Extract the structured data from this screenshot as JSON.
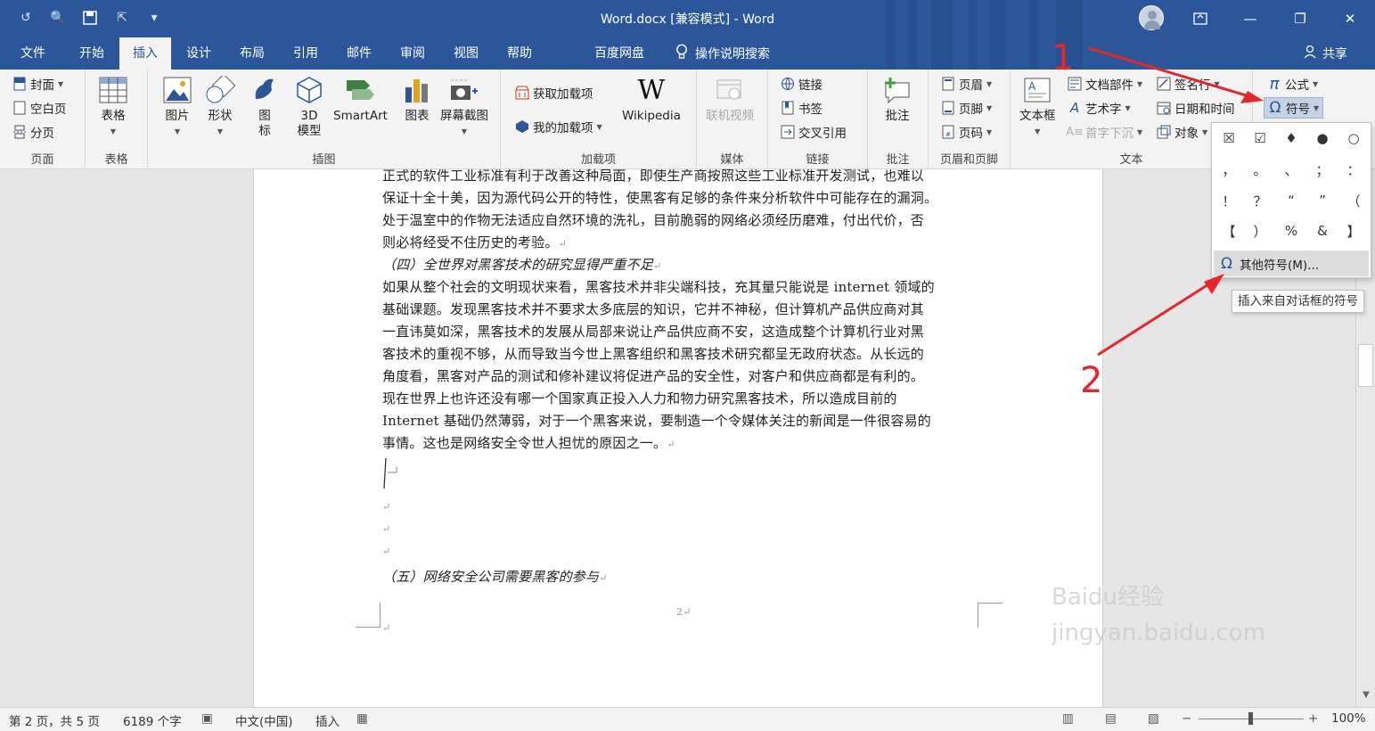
{
  "window": {
    "title": "Word.docx [兼容模式] - Word"
  },
  "tabs": [
    {
      "label": "文件"
    },
    {
      "label": "开始"
    },
    {
      "label": "插入",
      "active": true
    },
    {
      "label": "设计"
    },
    {
      "label": "布局"
    },
    {
      "label": "引用"
    },
    {
      "label": "邮件"
    },
    {
      "label": "审阅"
    },
    {
      "label": "视图"
    },
    {
      "label": "帮助"
    },
    {
      "label": "百度网盘"
    }
  ],
  "tellme": "操作说明搜索",
  "share": "共享",
  "ribbon": {
    "pages": {
      "label": "页面",
      "cover": "封面",
      "blank": "空白页",
      "break": "分页"
    },
    "table": {
      "label": "表格",
      "table": "表格"
    },
    "illustrations": {
      "label": "插图",
      "picture": "图片",
      "shapes": "形状",
      "icons": "图标",
      "model3d": "3D\n模型",
      "smartart": "SmartArt",
      "chart": "图表",
      "screenshot": "屏幕截图"
    },
    "addins": {
      "label": "加载项",
      "get": "获取加载项",
      "my": "我的加载项",
      "wikipedia": "Wikipedia"
    },
    "media": {
      "label": "媒体",
      "video": "联机视频"
    },
    "links": {
      "label": "链接",
      "link": "链接",
      "bookmark": "书签",
      "crossref": "交叉引用"
    },
    "comments": {
      "label": "批注",
      "comment": "批注"
    },
    "headerfooter": {
      "label": "页眉和页脚",
      "header": "页眉",
      "footer": "页脚",
      "pagenum": "页码"
    },
    "text": {
      "label": "文本",
      "textbox": "文本框",
      "parts": "文档部件",
      "wordart": "艺术字",
      "dropcap": "首字下沉",
      "signature": "签名行",
      "datetime": "日期和时间",
      "object": "对象"
    },
    "symbols": {
      "equation": "公式",
      "symbol": "符号"
    }
  },
  "document": {
    "lines": [
      "正式的软件工业标准有利于改善这种局面，即使生产商按照这些工业标准开发测试，也难以",
      "保证十全十美，因为源代码公开的特性，使黑客有足够的条件来分析软件中可能存在的漏洞。",
      "处于温室中的作物无法适应自然环境的洗礼，目前脆弱的网络必须经历磨难，付出代价，否",
      "则必将经受不住历史的考验。",
      "（四）全世界对黑客技术的研究显得严重不足",
      "如果从整个社会的文明现状来看，黑客技术并非尖端科技，充其量只能说是 internet 领域的",
      "基础课题。发现黑客技术并不要求太多底层的知识，它并不神秘，但计算机产品供应商对其",
      "一直讳莫如深，黑客技术的发展从局部来说让产品供应商不安，这造成整个计算机行业对黑",
      "客技术的重视不够，从而导致当今世上黑客组织和黑客技术研究都呈无政府状态。从长远的",
      "角度看，黑客对产品的测试和修补建议将促进产品的安全性，对客户和供应商都是有利的。",
      "现在世界上也许还没有哪一个国家真正投入人力和物力研究黑客技术，所以造成目前的",
      "Internet 基础仍然薄弱，对于一个黑客来说，要制造一个令媒体关注的新闻是一件很容易的",
      "事情。这也是网络安全令世人担忧的原因之一。"
    ],
    "heading5": "（五）网络安全公司需要黑客的参与",
    "page_number": "2"
  },
  "symbol_menu": {
    "symbols": [
      "☒",
      "☑",
      "♦",
      "●",
      "○",
      "，",
      "。",
      "、",
      "；",
      "：",
      "！",
      "？",
      "“",
      "”",
      "（",
      "【",
      "）",
      "%",
      "&",
      "】"
    ],
    "more": "其他符号(M)...",
    "tooltip": "插入来自对话框的符号"
  },
  "annotations": {
    "one": "1",
    "two": "2",
    "color": "#e8262a"
  },
  "status": {
    "page": "第 2 页，共 5 页",
    "words": "6189 个字",
    "lang": "中文(中国)",
    "mode": "插入",
    "zoom": "100%"
  },
  "watermark": "Baidu经验\njingyan.baidu.com",
  "colors": {
    "brand": "#2b579a"
  }
}
